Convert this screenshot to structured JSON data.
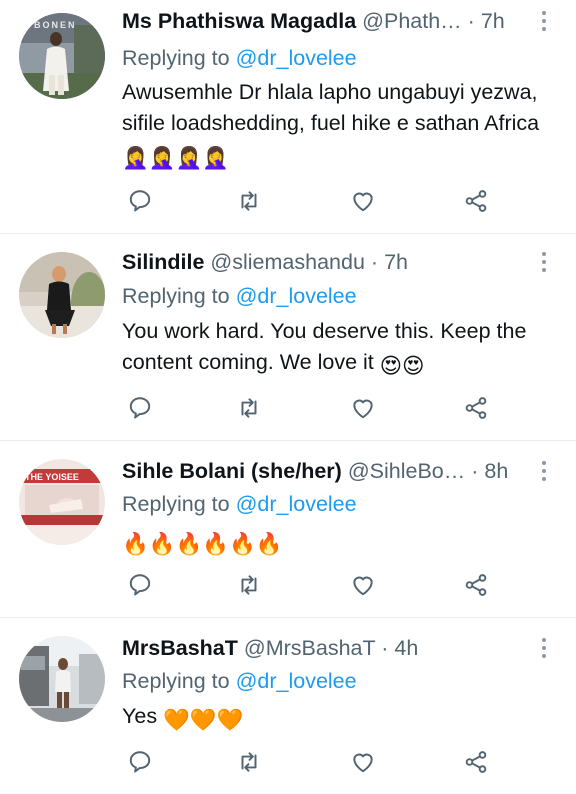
{
  "tweets": [
    {
      "name": "Ms Phathiswa Magadla",
      "handle": "@Phath…",
      "separator": "·",
      "time": "7h",
      "replying_prefix": "Replying to",
      "replying_to": "@dr_lovelee",
      "text": "Awusemhle Dr hlala lapho ungabuyi yezwa, sifile loadshedding, fuel hike e sathan Africa",
      "emoji": "🤦‍♀️🤦‍♀️🤦‍♀️🤦‍♀️",
      "avatar_caption": "BONEN"
    },
    {
      "name": "Silindile",
      "handle": "@sliemashandu",
      "separator": "·",
      "time": "7h",
      "replying_prefix": "Replying to",
      "replying_to": "@dr_lovelee",
      "text": "You work hard. You deserve this. Keep the content coming. We love it",
      "emoji": "😍😍"
    },
    {
      "name": "Sihle Bolani (she/her)",
      "handle": "@SihleBo…",
      "separator": "·",
      "time": "8h",
      "replying_prefix": "Replying to",
      "replying_to": "@dr_lovelee",
      "text": "",
      "emoji": "🔥🔥🔥🔥🔥🔥",
      "avatar_caption": "THE YOISEE"
    },
    {
      "name": "MrsBashaT",
      "handle": "@MrsBashaT",
      "separator": "·",
      "time": "4h",
      "replying_prefix": "Replying to",
      "replying_to": "@dr_lovelee",
      "text": "Yes",
      "emoji": "🧡🧡🧡"
    }
  ],
  "icons": {
    "reply": "reply-icon",
    "retweet": "retweet-icon",
    "like": "heart-icon",
    "share": "share-icon",
    "more": "more-options-icon"
  },
  "colors": {
    "link": "#1d9bf0",
    "secondary_text": "#536471",
    "primary_text": "#0f1419",
    "divider": "#e6ecf0",
    "icon": "#536471"
  }
}
